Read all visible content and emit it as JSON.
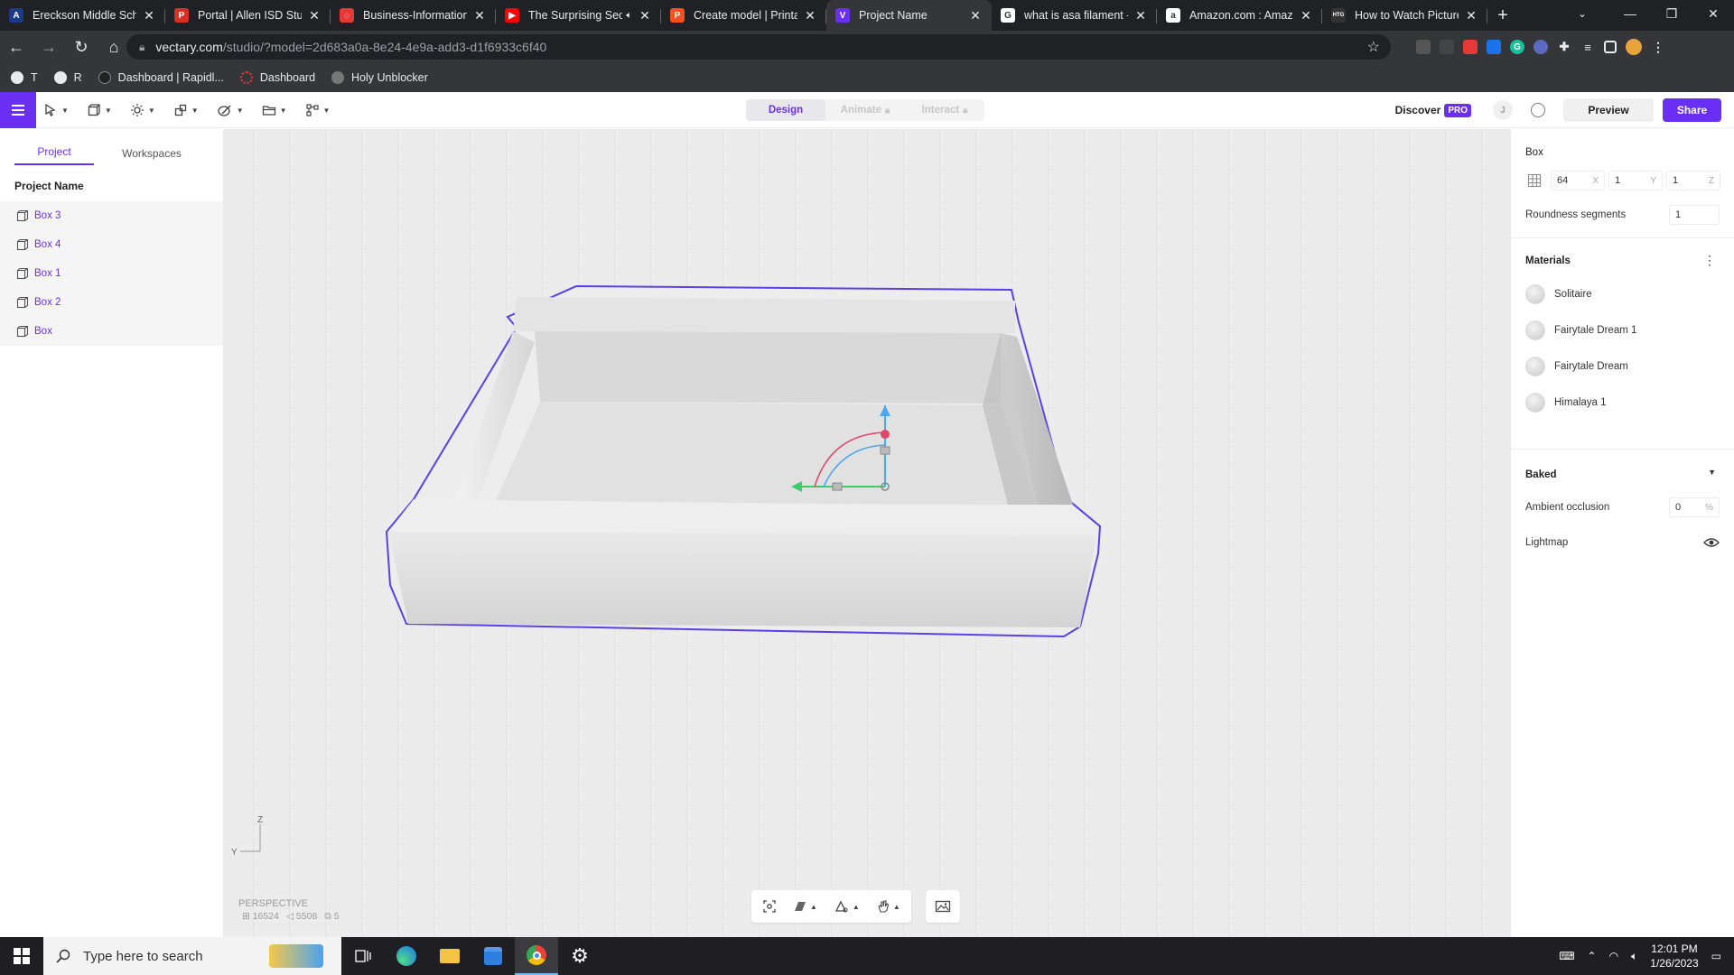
{
  "browser": {
    "tabs": [
      {
        "title": "Ereckson Middle Scho",
        "color": "#1b3a8a",
        "glyph": "A"
      },
      {
        "title": "Portal | Allen ISD Stud",
        "color": "#d93025",
        "glyph": "P"
      },
      {
        "title": "Business-Information |",
        "color": "#e53935",
        "glyph": "◌"
      },
      {
        "title": "The Surprising Sec",
        "color": "#ff0000",
        "glyph": "▶",
        "audio": true
      },
      {
        "title": "Create model | Printal",
        "color": "#f4511e",
        "glyph": "P"
      },
      {
        "title": "Project Name",
        "color": "#6b2ff3",
        "glyph": "V",
        "active": true
      },
      {
        "title": "what is asa filament -",
        "color": "#ffffff",
        "glyph": "G"
      },
      {
        "title": "Amazon.com : Amazo",
        "color": "#ffffff",
        "glyph": "a"
      },
      {
        "title": "How to Watch Picture",
        "color": "#333333",
        "glyph": "HTG"
      }
    ],
    "url_host": "vectary.com",
    "url_path": "/studio/?model=2d683a0a-8e24-4e9a-add3-d1f6933c6f40",
    "bookmarks": [
      {
        "label": "T"
      },
      {
        "label": "R"
      },
      {
        "label": "Dashboard | Rapidl..."
      },
      {
        "label": "Dashboard"
      },
      {
        "label": "Holy Unblocker"
      }
    ]
  },
  "app": {
    "modes": {
      "design": "Design",
      "animate": "Animate",
      "interact": "Interact"
    },
    "discover": "Discover",
    "pro_badge": "PRO",
    "avatar_initial": "J",
    "preview": "Preview",
    "share": "Share",
    "left_panel": {
      "tabs": {
        "project": "Project",
        "workspaces": "Workspaces"
      },
      "project_name": "Project Name",
      "items": [
        "Box 3",
        "Box 4",
        "Box 1",
        "Box 2",
        "Box"
      ]
    },
    "viewport": {
      "camera": "PERSPECTIVE",
      "stats": {
        "vertices": "16524",
        "faces": "5508",
        "objects": "5"
      },
      "axis_labels": {
        "z": "Z",
        "y": "Y"
      }
    },
    "right_panel": {
      "title": "Box",
      "dims": {
        "x": "64",
        "x_label": "X",
        "y": "1",
        "y_label": "Y",
        "z": "1",
        "z_label": "Z"
      },
      "roundness_label": "Roundness segments",
      "roundness_value": "1",
      "materials_label": "Materials",
      "materials": [
        "Solitaire",
        "Fairytale Dream 1",
        "Fairytale Dream",
        "Himalaya 1"
      ],
      "baked_label": "Baked",
      "ao_label": "Ambient occlusion",
      "ao_value": "0",
      "ao_unit": "%",
      "lightmap_label": "Lightmap"
    }
  },
  "taskbar": {
    "search_placeholder": "Type here to search",
    "time": "12:01 PM",
    "date": "1/26/2023"
  },
  "colors": {
    "accent": "#6b2ff3",
    "selection_outline": "#5b3fe8"
  }
}
